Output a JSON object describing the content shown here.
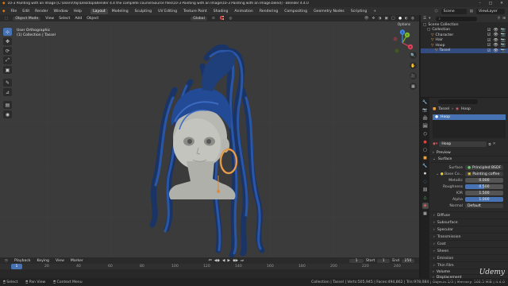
{
  "titlebar": {
    "title": "10-3 Painting with an Image [C:\\Users\\Yoji\\Desktop\\Blender 4.4 the complete course\\Source files\\10-3 Painting with an Image\\10-3 Painting with an Image.blend] - Blender 4.4.0",
    "minimize": "–",
    "maximize": "□",
    "close": "✕"
  },
  "menubar": {
    "logo": "◆",
    "menus": [
      "File",
      "Edit",
      "Render",
      "Window",
      "Help"
    ],
    "workspaces": [
      "Layout",
      "Modeling",
      "Sculpting",
      "UV Editing",
      "Texture Paint",
      "Shading",
      "Animation",
      "Rendering",
      "Compositing",
      "Geometry Nodes",
      "Scripting"
    ],
    "active_workspace": "Layout",
    "add_tab": "+",
    "scene": "Scene",
    "view_layer": "ViewLayer"
  },
  "viewport": {
    "mode": "Object Mode",
    "menus": [
      "View",
      "Select",
      "Add",
      "Object"
    ],
    "orientation": "Global",
    "options": "Options",
    "info_line1": "User Orthographic",
    "info_line2": "(1) Collection | Tassel",
    "gizmo": {
      "x": "X",
      "y": "Y",
      "z": "Z"
    }
  },
  "tools": [
    "⊹",
    "✥",
    "⟳",
    "⤢",
    "▣",
    "✎",
    "⊿",
    "▤",
    "◉"
  ],
  "nav_buttons": [
    "🔍",
    "✋",
    "🎥",
    "▦"
  ],
  "timeline": {
    "menus": [
      "Playback",
      "Keying",
      "View",
      "Marker"
    ],
    "transport": [
      "⏮",
      "◀◆",
      "◀",
      "▶",
      "◆▶",
      "⏭"
    ],
    "current_frame": "1",
    "start_label": "Start",
    "start": "1",
    "end_label": "End",
    "end": "250",
    "ticks": [
      "0",
      "20",
      "40",
      "60",
      "80",
      "100",
      "120",
      "140",
      "160",
      "180",
      "200",
      "220",
      "240"
    ]
  },
  "statusbar": {
    "items": [
      "Select",
      "Pan View",
      "Context Menu"
    ],
    "stats": "Collection | Tassel | Verts:505,945 | Faces:494,862 | Tris:978,084 | Objects:1/3 | Memory: 166.5 MiB | 4.4.0"
  },
  "outliner": {
    "search_placeholder": "",
    "items": [
      {
        "label": "Scene Collection",
        "indent": 0
      },
      {
        "label": "Collection",
        "indent": 1
      },
      {
        "label": "Character",
        "indent": 2
      },
      {
        "label": "Hair",
        "indent": 2
      },
      {
        "label": "Hoop",
        "indent": 2
      },
      {
        "label": "Tassel",
        "indent": 3,
        "selected": true
      }
    ]
  },
  "properties": {
    "object_name": "Tassel",
    "material_tab": "Hoop",
    "material_slot": "Hoop",
    "material_name": "Hoop",
    "preview": "Preview",
    "surface_section": "Surface",
    "surface_label": "Surface",
    "surface_value": "Principled BSDF",
    "base_color_label": "Base Co...",
    "base_color_value": "Painting coffee",
    "fields": [
      {
        "label": "Metallic",
        "value": "0.000",
        "fill": 0
      },
      {
        "label": "Roughness",
        "value": "0.500",
        "fill": 0.5
      },
      {
        "label": "IOR",
        "value": "1.500",
        "fill": 0
      },
      {
        "label": "Alpha",
        "value": "1.000",
        "fill": 1
      }
    ],
    "normal_label": "Normal",
    "normal_value": "Default",
    "subsections": [
      "Diffuse",
      "Subsurface",
      "Specular",
      "Transmission",
      "Coat",
      "Sheen",
      "Emission",
      "Thin Film"
    ],
    "volume": "Volume",
    "displacement": "Displacement"
  },
  "watermark": "Udemy",
  "colors": {
    "accent": "#4772b3",
    "hair": "#1f3f7a",
    "skin": "#b5b5b0",
    "hoop": "#d98a3a"
  }
}
